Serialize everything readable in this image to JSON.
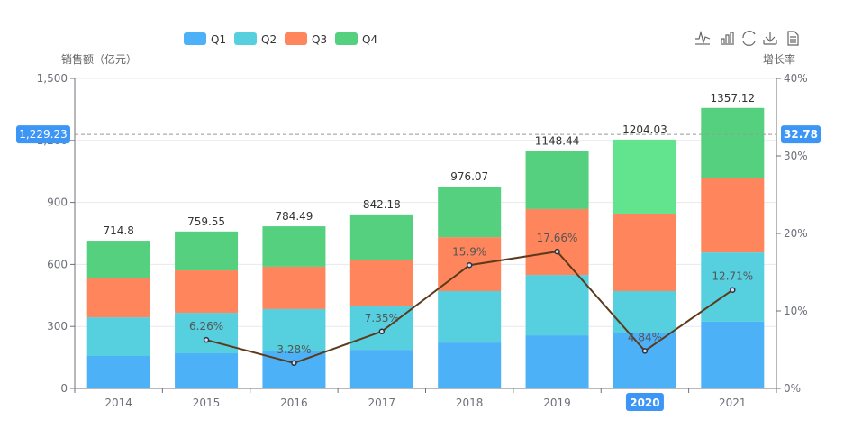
{
  "chart_data": {
    "type": "bar",
    "stacked": true,
    "categories": [
      "2014",
      "2015",
      "2016",
      "2017",
      "2018",
      "2019",
      "2020",
      "2021"
    ],
    "series": [
      {
        "name": "Q1",
        "color": "#4cb1f7",
        "values": [
          157,
          170,
          183,
          187,
          222,
          257,
          270,
          323
        ]
      },
      {
        "name": "Q2",
        "color": "#56cfdf",
        "values": [
          187,
          196,
          201,
          210,
          249,
          292,
          201,
          335
        ]
      },
      {
        "name": "Q3",
        "color": "#fe855c",
        "values": [
          192,
          205,
          205,
          226,
          261,
          319,
          375,
          362
        ]
      },
      {
        "name": "Q4",
        "color": "#54d07f",
        "values": [
          178.8,
          188.55,
          195.49,
          219.18,
          244.07,
          280.44,
          358.03,
          337.12
        ]
      }
    ],
    "totals": [
      "714.8",
      "759.55",
      "784.49",
      "842.18",
      "976.07",
      "1148.44",
      "1204.03",
      "1357.12"
    ],
    "line": {
      "axis": "right",
      "color": "#5c3a1c",
      "values": [
        null,
        6.26,
        3.28,
        7.35,
        15.9,
        17.66,
        4.84,
        12.71
      ],
      "labels": [
        "",
        "6.26%",
        "3.28%",
        "7.35%",
        "15.9%",
        "17.66%",
        "4.84%",
        "12.71%"
      ]
    },
    "ylabel": "销售额（亿元）",
    "ylim": [
      0,
      1500
    ],
    "yticks": [
      "0",
      "300",
      "600",
      "900",
      "1,200",
      "1,500"
    ],
    "y2label": "增长率",
    "y2lim": [
      0,
      40
    ],
    "y2ticks": [
      "0%",
      "10%",
      "20%",
      "30%",
      "40%"
    ],
    "grid": true,
    "legend_position": "top-center",
    "crosshair": {
      "category": "2020",
      "y_value": 1229.23,
      "y_label": "1,229.23",
      "y2_label": "32.78",
      "highlight_color": "#3d96f5"
    },
    "toolbox": [
      "line-chart-icon",
      "bar-chart-icon",
      "restore-icon",
      "download-icon",
      "data-view-icon"
    ]
  }
}
